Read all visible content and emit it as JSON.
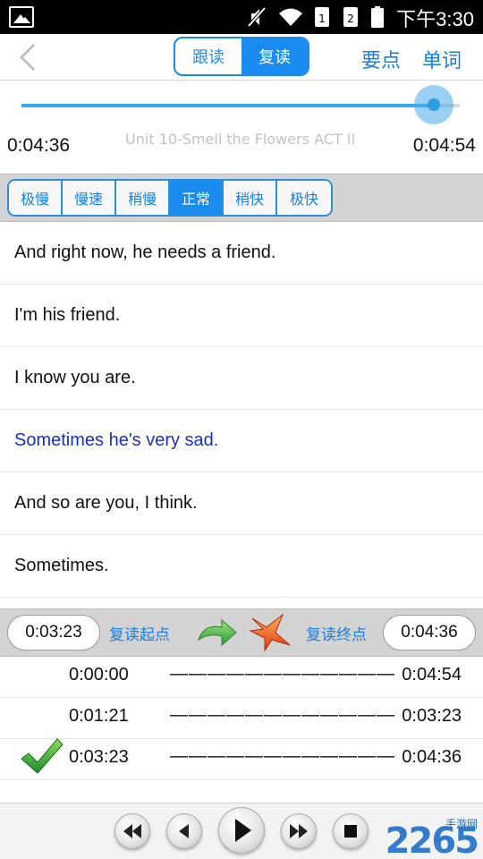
{
  "status_bar": {
    "time": "下午3:30",
    "icons": [
      "gallery-icon",
      "mute-icon",
      "wifi-icon",
      "sim1-icon",
      "sim2-icon",
      "battery-icon"
    ]
  },
  "title_bar": {
    "back_icon": "chevron-left-icon",
    "tabs": [
      {
        "label": "跟读",
        "active": false
      },
      {
        "label": "复读",
        "active": true
      }
    ],
    "key_points_label": "要点",
    "vocabulary_label": "单词"
  },
  "player": {
    "current_time": "0:04:36",
    "total_time": "0:04:54",
    "progress_fraction": 0.94,
    "track_title": "Unit 10-Smell the Flowers ACT II"
  },
  "speeds": [
    {
      "label": "极慢",
      "active": false
    },
    {
      "label": "慢速",
      "active": false
    },
    {
      "label": "稍慢",
      "active": false
    },
    {
      "label": "正常",
      "active": true
    },
    {
      "label": "稍快",
      "active": false
    },
    {
      "label": "极快",
      "active": false
    }
  ],
  "sentences": [
    {
      "text": "And right now, he needs a friend.",
      "current": false
    },
    {
      "text": "I'm his friend.",
      "current": false
    },
    {
      "text": "I know you are.",
      "current": false
    },
    {
      "text": "Sometimes he's very sad.",
      "current": true
    },
    {
      "text": "And so are you, I think.",
      "current": false
    },
    {
      "text": "Sometimes.",
      "current": false
    }
  ],
  "repeat": {
    "start_value": "0:03:23",
    "start_label": "复读起点",
    "end_value": "0:04:36",
    "end_label": "复读终点",
    "rows": [
      {
        "start": "0:00:00",
        "dash": "————————————",
        "end": "0:04:54",
        "selected": false
      },
      {
        "start": "0:01:21",
        "dash": "————————————",
        "end": "0:03:23",
        "selected": false
      },
      {
        "start": "0:03:23",
        "dash": "————————————",
        "end": "0:04:36",
        "selected": true
      }
    ]
  },
  "controls": [
    "rewind-icon",
    "previous-icon",
    "play-icon",
    "fast-forward-icon",
    "stop-icon"
  ],
  "watermark": {
    "text": "2265",
    "sub": "手游网"
  },
  "colors": {
    "accent": "#1a8cf0",
    "current_sentence": "#1a2fc0"
  }
}
